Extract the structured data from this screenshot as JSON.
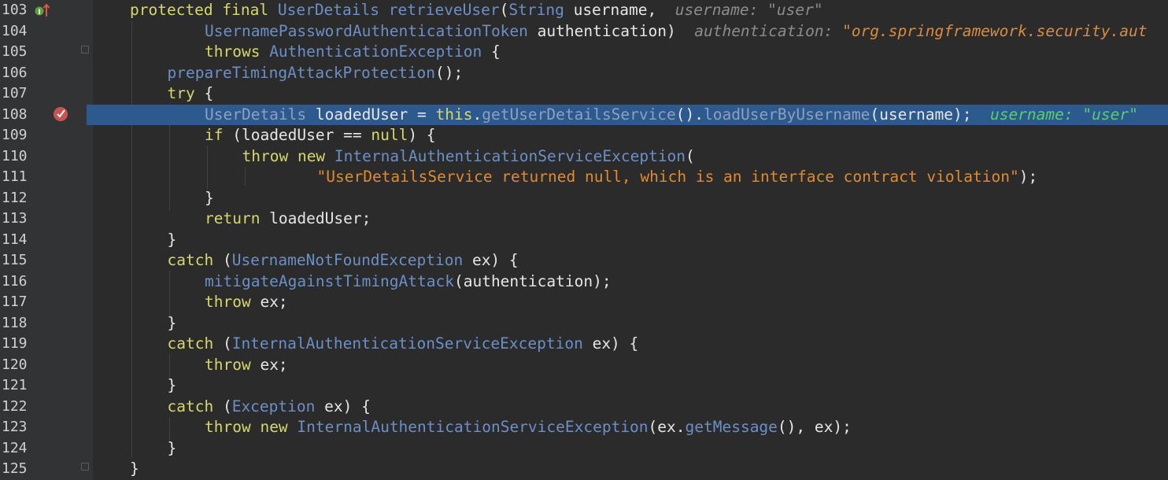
{
  "editor": {
    "lines": [
      {
        "num": "103",
        "indent": 0,
        "tokens": [
          {
            "t": "protected ",
            "c": "kwl"
          },
          {
            "t": "final ",
            "c": "kwl"
          },
          {
            "t": "UserDetails ",
            "c": "tyl"
          },
          {
            "t": "retrieveUser",
            "c": "tyl"
          },
          {
            "t": "(",
            "c": "id"
          },
          {
            "t": "String ",
            "c": "tyl"
          },
          {
            "t": "username,",
            "c": "id"
          },
          {
            "t": "  username: \"user\"",
            "c": "hint"
          }
        ]
      },
      {
        "num": "104",
        "indent": 2,
        "tokens": [
          {
            "t": "UsernamePasswordAuthenticationToken ",
            "c": "tyl"
          },
          {
            "t": "authentication)",
            "c": "id"
          },
          {
            "t": "  authentication: ",
            "c": "hint"
          },
          {
            "t": "\"org.springframework.security.aut",
            "c": "hintv"
          }
        ]
      },
      {
        "num": "105",
        "indent": 2,
        "tokens": [
          {
            "t": "throws ",
            "c": "kwl"
          },
          {
            "t": "AuthenticationException ",
            "c": "tyl"
          },
          {
            "t": "{",
            "c": "id"
          }
        ]
      },
      {
        "num": "106",
        "indent": 1,
        "tokens": [
          {
            "t": "prepareTimingAttackProtection",
            "c": "tyl"
          },
          {
            "t": "();",
            "c": "id"
          }
        ]
      },
      {
        "num": "107",
        "indent": 1,
        "tokens": [
          {
            "t": "try ",
            "c": "kwl"
          },
          {
            "t": "{",
            "c": "id"
          }
        ]
      },
      {
        "num": "108",
        "indent": 2,
        "current": true,
        "tokens": [
          {
            "t": "UserDetails ",
            "c": "ce"
          },
          {
            "t": "loadedUser = ",
            "c": "id"
          },
          {
            "t": "this",
            "c": "kwl"
          },
          {
            "t": ".",
            "c": "id"
          },
          {
            "t": "getUserDetailsService",
            "c": "ce"
          },
          {
            "t": "().",
            "c": "id"
          },
          {
            "t": "loadUserByUsername",
            "c": "ce"
          },
          {
            "t": "(username);",
            "c": "id"
          },
          {
            "t": "  username: \"user\"",
            "c": "hintg"
          }
        ]
      },
      {
        "num": "109",
        "indent": 2,
        "tokens": [
          {
            "t": "if ",
            "c": "kwl"
          },
          {
            "t": "(loadedUser == ",
            "c": "id"
          },
          {
            "t": "null",
            "c": "kwl"
          },
          {
            "t": ") {",
            "c": "id"
          }
        ]
      },
      {
        "num": "110",
        "indent": 3,
        "tokens": [
          {
            "t": "throw ",
            "c": "kwl"
          },
          {
            "t": "new ",
            "c": "kwl"
          },
          {
            "t": "InternalAuthenticationServiceException",
            "c": "tyl"
          },
          {
            "t": "(",
            "c": "id"
          }
        ]
      },
      {
        "num": "111",
        "indent": 5,
        "tokens": [
          {
            "t": "\"UserDetailsService returned null, which is an interface contract violation\"",
            "c": "str"
          },
          {
            "t": ");",
            "c": "id"
          }
        ]
      },
      {
        "num": "112",
        "indent": 2,
        "tokens": [
          {
            "t": "}",
            "c": "id"
          }
        ]
      },
      {
        "num": "113",
        "indent": 2,
        "tokens": [
          {
            "t": "return ",
            "c": "kwl"
          },
          {
            "t": "loadedUser;",
            "c": "id"
          }
        ]
      },
      {
        "num": "114",
        "indent": 1,
        "tokens": [
          {
            "t": "}",
            "c": "id"
          }
        ]
      },
      {
        "num": "115",
        "indent": 1,
        "tokens": [
          {
            "t": "catch ",
            "c": "kwl"
          },
          {
            "t": "(",
            "c": "id"
          },
          {
            "t": "UsernameNotFoundException ",
            "c": "tyl"
          },
          {
            "t": "ex) {",
            "c": "id"
          }
        ]
      },
      {
        "num": "116",
        "indent": 2,
        "tokens": [
          {
            "t": "mitigateAgainstTimingAttack",
            "c": "tyl"
          },
          {
            "t": "(authentication);",
            "c": "id"
          }
        ]
      },
      {
        "num": "117",
        "indent": 2,
        "tokens": [
          {
            "t": "throw ",
            "c": "kwl"
          },
          {
            "t": "ex;",
            "c": "id"
          }
        ]
      },
      {
        "num": "118",
        "indent": 1,
        "tokens": [
          {
            "t": "}",
            "c": "id"
          }
        ]
      },
      {
        "num": "119",
        "indent": 1,
        "tokens": [
          {
            "t": "catch ",
            "c": "kwl"
          },
          {
            "t": "(",
            "c": "id"
          },
          {
            "t": "InternalAuthenticationServiceException ",
            "c": "tyl"
          },
          {
            "t": "ex) {",
            "c": "id"
          }
        ]
      },
      {
        "num": "120",
        "indent": 2,
        "tokens": [
          {
            "t": "throw ",
            "c": "kwl"
          },
          {
            "t": "ex;",
            "c": "id"
          }
        ]
      },
      {
        "num": "121",
        "indent": 1,
        "tokens": [
          {
            "t": "}",
            "c": "id"
          }
        ]
      },
      {
        "num": "122",
        "indent": 1,
        "tokens": [
          {
            "t": "catch ",
            "c": "kwl"
          },
          {
            "t": "(",
            "c": "id"
          },
          {
            "t": "Exception ",
            "c": "tyl"
          },
          {
            "t": "ex) {",
            "c": "id"
          }
        ]
      },
      {
        "num": "123",
        "indent": 2,
        "tokens": [
          {
            "t": "throw ",
            "c": "kwl"
          },
          {
            "t": "new ",
            "c": "kwl"
          },
          {
            "t": "InternalAuthenticationServiceException",
            "c": "tyl"
          },
          {
            "t": "(ex.",
            "c": "id"
          },
          {
            "t": "getMessage",
            "c": "tyl"
          },
          {
            "t": "(), ex);",
            "c": "id"
          }
        ]
      },
      {
        "num": "124",
        "indent": 1,
        "tokens": [
          {
            "t": "}",
            "c": "id"
          }
        ]
      },
      {
        "num": "125",
        "indent": 0,
        "tokens": [
          {
            "t": "}",
            "c": "id"
          }
        ]
      }
    ],
    "colors": {
      "background": "#2b2b2b",
      "gutter": "#313335",
      "current_line": "#2d5a8e",
      "breakpoint": "#c75450"
    },
    "gutter_icons": {
      "override_icon": "override-implements-icon",
      "breakpoint_icon": "breakpoint-check-icon"
    }
  }
}
